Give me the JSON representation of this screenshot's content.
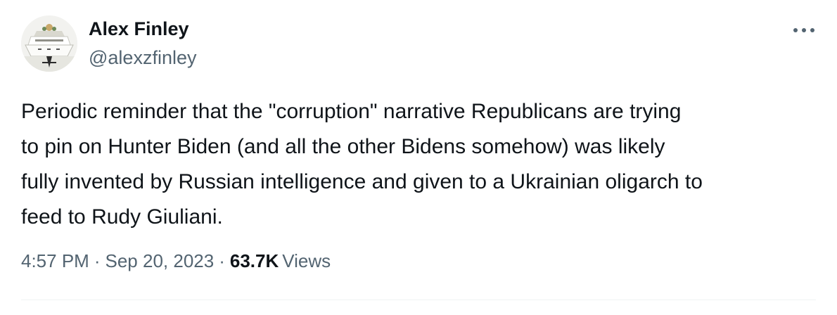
{
  "author": {
    "name": "Alex Finley",
    "handle": "@alexzfinley",
    "avatar": "yacht-avatar-image"
  },
  "tweet": {
    "text": "Periodic reminder that the \"corruption\" narrative Republicans are trying\nto pin on Hunter Biden (and all the other Bidens somehow) was likely\nfully invented by Russian intelligence and given to a Ukrainian oligarch to\nfeed to Rudy Giuliani."
  },
  "meta": {
    "time": "4:57 PM",
    "separator": "·",
    "date": "Sep 20, 2023",
    "views_count": "63.7K",
    "views_label": "Views"
  },
  "icons": {
    "more": "more-options-icon"
  },
  "colors": {
    "text_primary": "#0f1419",
    "text_secondary": "#536471",
    "divider": "#eff3f4"
  }
}
